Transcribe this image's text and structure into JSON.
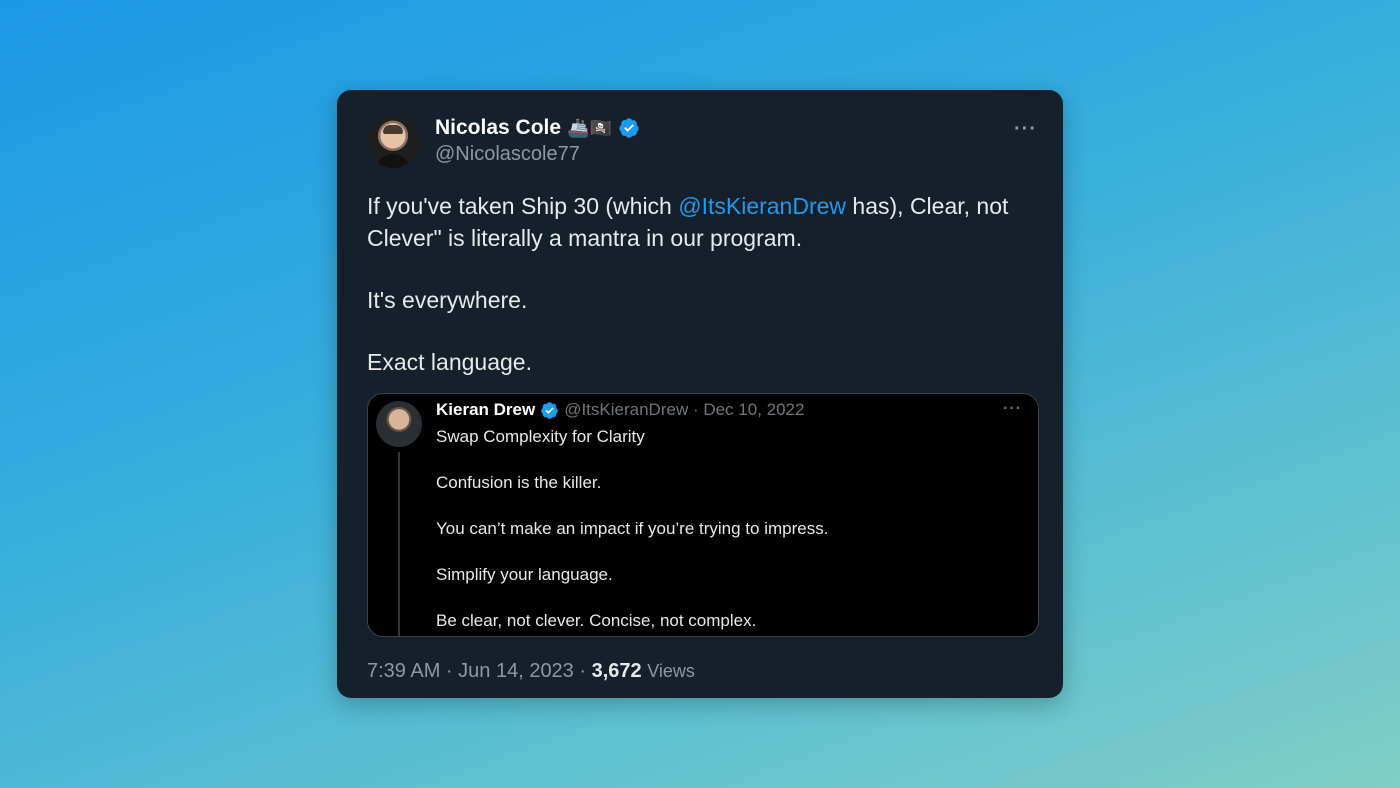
{
  "tweet": {
    "author_name": "Nicolas Cole",
    "author_emojis": "🚢🏴‍☠️",
    "handle": "@Nicolascole77",
    "more_label": "···",
    "text": {
      "line1_prefix": "If you've taken Ship 30 (which ",
      "mention": "@ItsKieranDrew",
      "line1_suffix": " has),  Clear, not Clever\" is literally a mantra in our program.",
      "para2": "It's everywhere.",
      "para3": "Exact language."
    },
    "timestamp": "7:39 AM · Jun 14, 2023 · ",
    "view_count": "3,672",
    "views_label": "Views"
  },
  "quoted": {
    "author_name": "Kieran Drew",
    "meta": "@ItsKieranDrew · Dec 10, 2022",
    "more_label": "···",
    "paragraphs": [
      "Swap Complexity for Clarity",
      "Confusion is the killer.",
      "You can’t make an impact if you’re trying to impress.",
      "Simplify your language.",
      "Be clear, not clever. Concise, not complex."
    ]
  },
  "colors": {
    "card_bg": "#15202b",
    "accent": "#1d9bf0",
    "quote_bg": "#000000"
  }
}
